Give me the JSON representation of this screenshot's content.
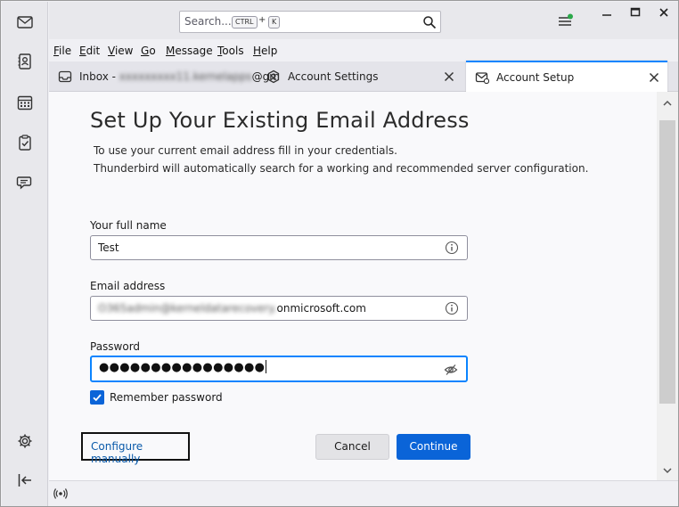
{
  "search": {
    "placeholder": "Search...",
    "key1": "CTRL",
    "plus": "+",
    "key2": "K"
  },
  "menubar": [
    {
      "accel": "F",
      "rest": "ile"
    },
    {
      "accel": "E",
      "rest": "dit"
    },
    {
      "accel": "V",
      "rest": "iew"
    },
    {
      "accel": "G",
      "rest": "o"
    },
    {
      "accel": "M",
      "rest": "essage"
    },
    {
      "accel": "T",
      "rest": "ools"
    },
    {
      "accel": "H",
      "rest": "elp"
    }
  ],
  "tabs": {
    "inbox": {
      "label_prefix": "Inbox - ",
      "label_blurred": "xxxxxxxxx11.kernelapps",
      "label_suffix": "@gm"
    },
    "settings": {
      "label": "Account Settings"
    },
    "setup": {
      "label": "Account Setup"
    }
  },
  "form": {
    "title": "Set Up Your Existing Email Address",
    "desc_line1": "To use your current email address fill in your credentials.",
    "desc_line2": "Thunderbird will automatically search for a working and recommended server configuration.",
    "name_label": "Your full name",
    "name_value": "Test",
    "email_label": "Email address",
    "email_blurred": "O365admin@kerneldatarecovery.",
    "email_visible": "onmicrosoft.com",
    "password_label": "Password",
    "password_masked": "●●●●●●●●●●●●●●●●",
    "remember_label": "Remember password",
    "remember_checked": true
  },
  "buttons": {
    "configure_manually": "Configure manually",
    "cancel": "Cancel",
    "continue": "Continue"
  },
  "colors": {
    "accent": "#0a64d8",
    "focus": "#0a84ff",
    "link": "#0a5aaa",
    "update_dot": "#2ba84a"
  }
}
